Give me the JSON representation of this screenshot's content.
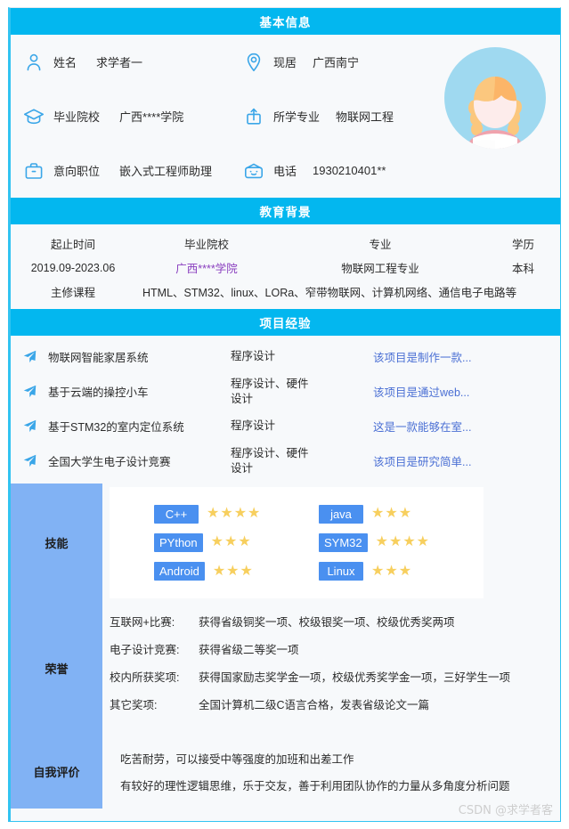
{
  "sections": {
    "basic": "基本信息",
    "education": "教育背景",
    "projects": "项目经验"
  },
  "basic": {
    "fields": [
      {
        "icon": "person-icon",
        "label": "姓名",
        "value": "求学者一"
      },
      {
        "icon": "location-icon",
        "label": "现居",
        "value": "广西南宁"
      },
      {
        "icon": "graduation-cap-icon",
        "label": "毕业院校",
        "value": "广西****学院"
      },
      {
        "icon": "book-icon",
        "label": "所学专业",
        "value": "物联网工程"
      },
      {
        "icon": "briefcase-icon",
        "label": "意向职位",
        "value": "嵌入式工程师助理"
      },
      {
        "icon": "telephone-icon",
        "label": "电话",
        "value": "1930210401**"
      }
    ],
    "avatar_alt": "avatar"
  },
  "education": {
    "headers": [
      "起止时间",
      "毕业院校",
      "专业",
      "学历"
    ],
    "row": [
      "2019.09-2023.06",
      "广西****学院",
      "物联网工程专业",
      "本科"
    ],
    "courses_label": "主修课程",
    "courses_value": "HTML、STM32、linux、LORa、窄带物联网、计算机网络、通信电子电路等"
  },
  "projects": [
    {
      "name": "物联网智能家居系统",
      "type": "程序设计",
      "desc": "该项目是制作一款..."
    },
    {
      "name": "基于云端的操控小车",
      "type": "程序设计、硬件设计",
      "desc": "该项目是通过web..."
    },
    {
      "name": "基于STM32的室内定位系统",
      "type": "程序设计",
      "desc": "这是一款能够在室..."
    },
    {
      "name": "全国大学生电子设计竞赛",
      "type": "程序设计、硬件设计",
      "desc": "该项目是研究简单..."
    }
  ],
  "skills": {
    "label": "技能",
    "items": [
      {
        "name": "C++",
        "stars": 4
      },
      {
        "name": "java",
        "stars": 3
      },
      {
        "name": "PYthon",
        "stars": 3
      },
      {
        "name": "SYM32",
        "stars": 4
      },
      {
        "name": "Android",
        "stars": 3
      },
      {
        "name": "Linux",
        "stars": 3
      }
    ]
  },
  "honors": {
    "label": "荣誉",
    "items": [
      {
        "key": "互联网+比赛:",
        "value": "获得省级铜奖一项、校级银奖一项、校级优秀奖两项"
      },
      {
        "key": "电子设计竞赛:",
        "value": "获得省级二等奖一项"
      },
      {
        "key": "校内所获奖项:",
        "value": "获得国家励志奖学金一项，校级优秀奖学金一项，三好学生一项"
      },
      {
        "key": "其它奖项:",
        "value": "全国计算机二级C语言合格，发表省级论文一篇"
      }
    ]
  },
  "evaluation": {
    "label": "自我评价",
    "lines": [
      "吃苦耐劳，可以接受中等强度的加班和出差工作",
      "有较好的理性逻辑思维，乐于交友，善于利用团队协作的力量从多角度分析问题"
    ]
  },
  "watermark": "CSDN @求学者客",
  "colors": {
    "header_bar": "#03b7ef",
    "side_label": "#81b2f4",
    "chip": "#4a90f0",
    "star": "#f7cf5e",
    "link": "#4a6fd4",
    "visited_link": "#8a3fbf",
    "page_bg": "#f7f9fb"
  }
}
